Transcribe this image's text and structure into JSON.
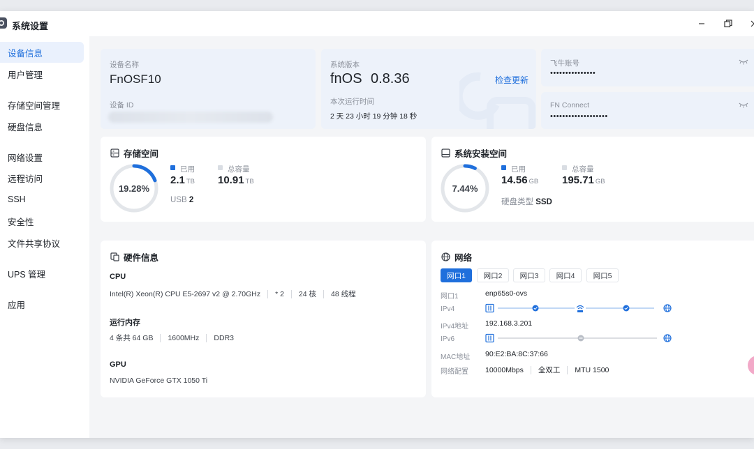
{
  "window": {
    "title": "系统设置",
    "controls": {
      "minimize": "–",
      "maximize": "⧉",
      "close": "✕"
    }
  },
  "sidebar": {
    "items": [
      {
        "label": "设备信息",
        "active": true
      },
      {
        "label": "用户管理"
      },
      {
        "label": "存储空间管理"
      },
      {
        "label": "硬盘信息"
      },
      {
        "label": "网络设置"
      },
      {
        "label": "远程访问"
      },
      {
        "label": "SSH"
      },
      {
        "label": "安全性"
      },
      {
        "label": "文件共享协议"
      },
      {
        "label": "UPS 管理"
      },
      {
        "label": "应用"
      }
    ]
  },
  "device": {
    "name_label": "设备名称",
    "name_value": "FnOSF10",
    "id_label": "设备 ID"
  },
  "system": {
    "version_label": "系统版本",
    "version_name": "fnOS",
    "version_number": "0.8.36",
    "check_update": "检查更新",
    "uptime_label": "本次运行时间",
    "uptime_value": "2 天 23 小时 19 分钟 18 秒"
  },
  "accounts": {
    "fei_label": "飞牛账号",
    "fei_value": "•••••••••••••••",
    "fn_label": "FN Connect",
    "fn_value": "•••••••••••••••••••"
  },
  "storage": {
    "title": "存储空间",
    "percent": "19.28%",
    "percent_value": 19.28,
    "used_label": "已用",
    "used_value": "2.1",
    "used_unit": "TB",
    "total_label": "总容量",
    "total_value": "10.91",
    "total_unit": "TB",
    "usb_label": "USB",
    "usb_value": "2"
  },
  "sysdisk": {
    "title": "系统安装空间",
    "percent": "7.44%",
    "percent_value": 7.44,
    "used_label": "已用",
    "used_value": "14.56",
    "used_unit": "GB",
    "total_label": "总容量",
    "total_value": "195.71",
    "total_unit": "GB",
    "type_label": "硬盘类型",
    "type_value": "SSD"
  },
  "hardware": {
    "title": "硬件信息",
    "cpu_label": "CPU",
    "cpu_model": "Intel(R) Xeon(R) CPU E5-2697 v2 @ 2.70GHz",
    "cpu_count": "* 2",
    "cpu_cores": "24 核",
    "cpu_threads": "48 线程",
    "ram_label": "运行内存",
    "ram_size": "4 条共 64 GB",
    "ram_speed": "1600MHz",
    "ram_type": "DDR3",
    "gpu_label": "GPU",
    "gpu_model": "NVIDIA GeForce GTX 1050 Ti"
  },
  "network": {
    "title": "网络",
    "tabs": [
      "网口1",
      "网口2",
      "网口3",
      "网口4",
      "网口5"
    ],
    "port_label": "网口1",
    "port_value": "enp65s0-ovs",
    "ipv4_label": "IPv4",
    "ipv4addr_label": "IPv4地址",
    "ipv4addr_value": "192.168.3.201",
    "ipv6_label": "IPv6",
    "mac_label": "MAC地址",
    "mac_value": "90:E2:BA:8C:37:66",
    "config_label": "网络配置",
    "speed": "10000Mbps",
    "duplex": "全双工",
    "mtu": "MTU 1500"
  },
  "colors": {
    "accent": "#1f6fdc",
    "ring_track": "#e3e6ea",
    "legend_total": "#d9dde3"
  }
}
